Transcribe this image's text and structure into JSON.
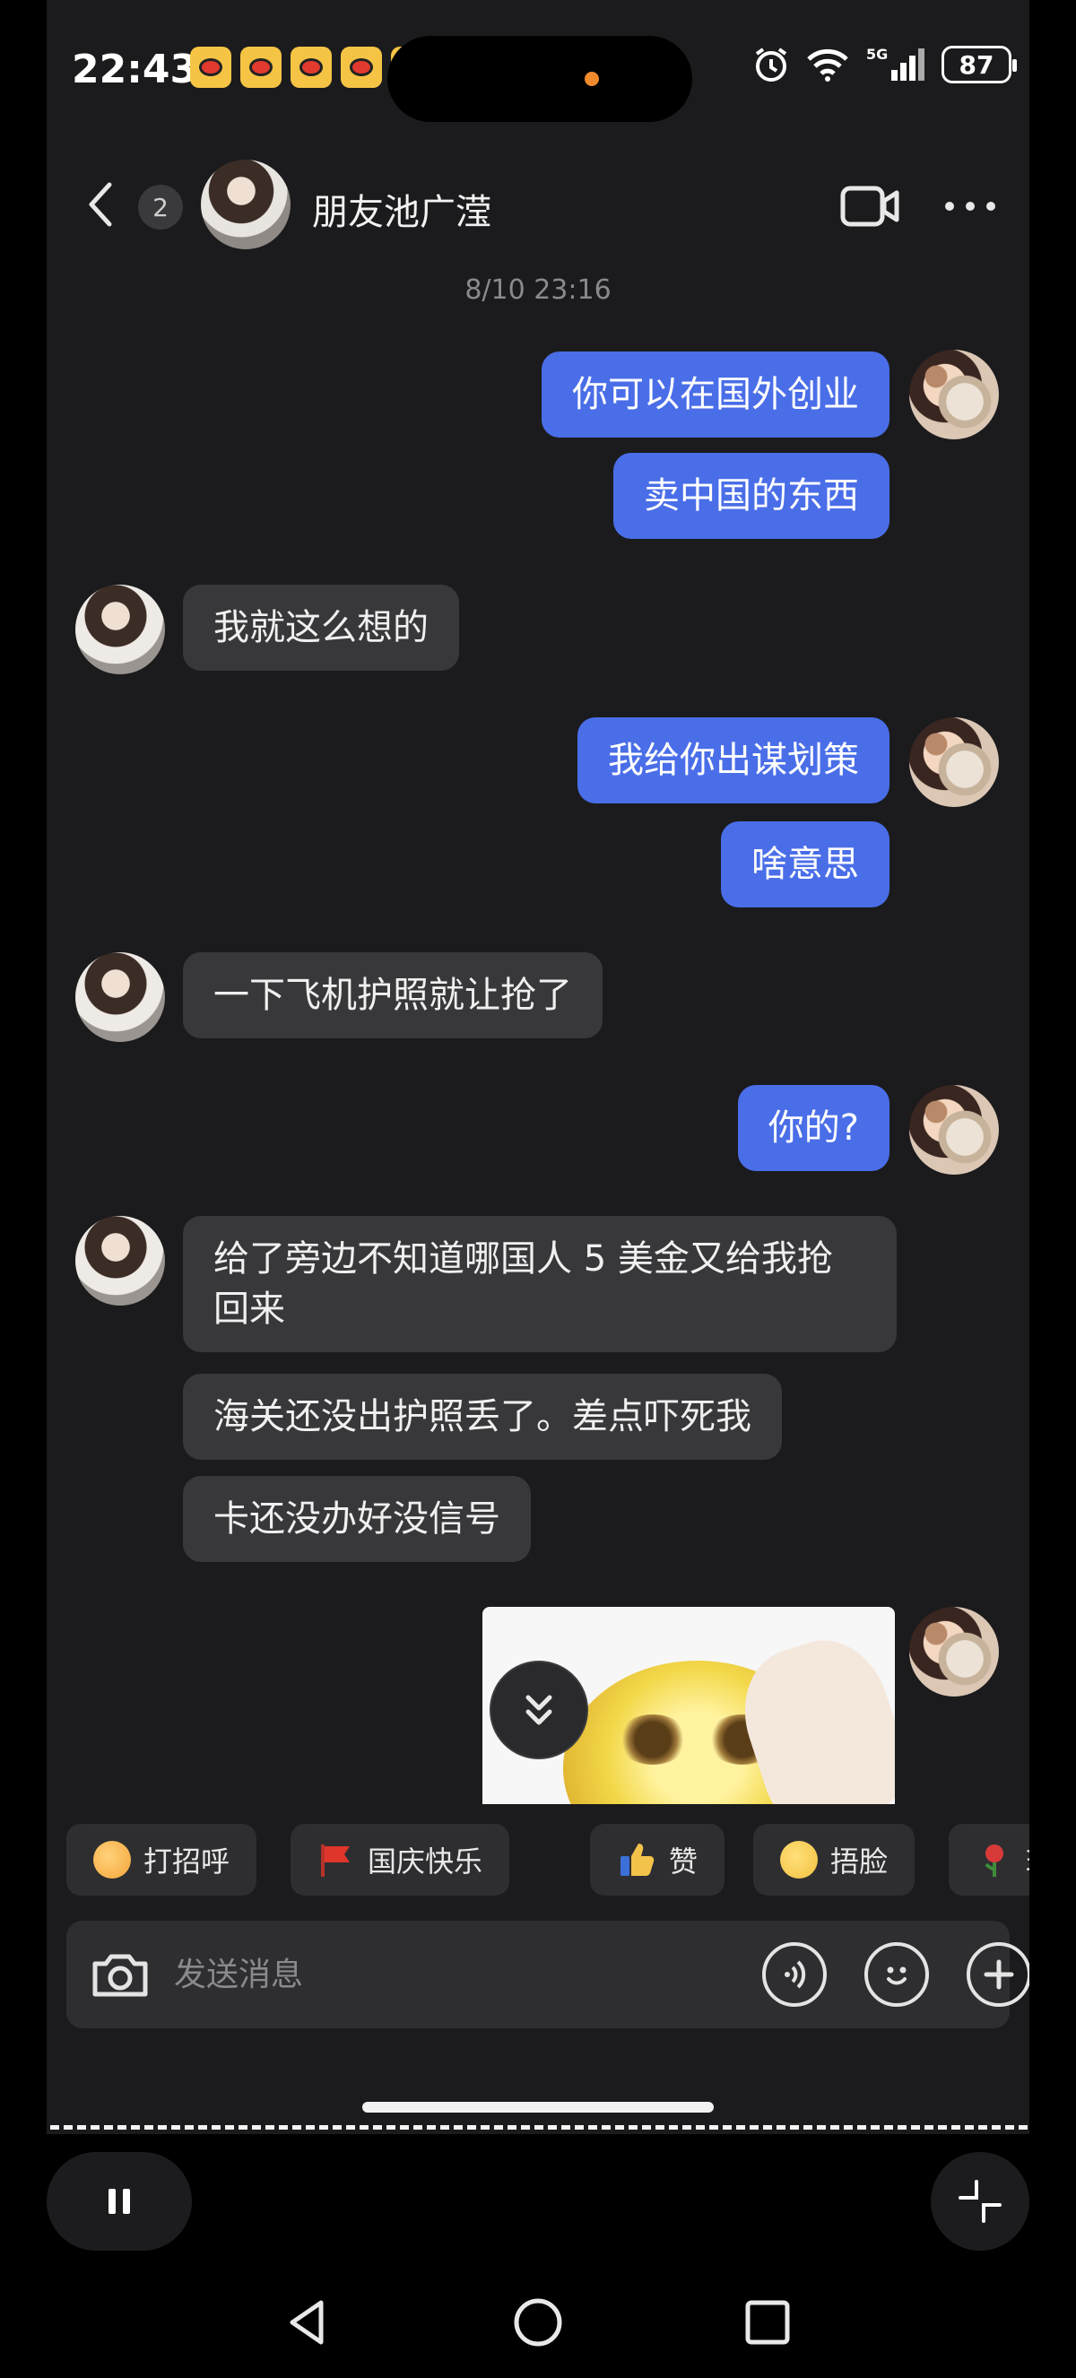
{
  "status_bar": {
    "time": "22:43",
    "dots": "···",
    "battery": "87",
    "network": "5G"
  },
  "header": {
    "unread_count": "2",
    "contact_name": "朋友池广滢"
  },
  "timestamp": "8/10 23:16",
  "messages": [
    {
      "side": "out",
      "text": "你可以在国外创业"
    },
    {
      "side": "out",
      "text": "卖中国的东西"
    },
    {
      "side": "in",
      "text": "我就这么想的"
    },
    {
      "side": "out",
      "text": "我给你出谋划策"
    },
    {
      "side": "out",
      "text": "啥意思"
    },
    {
      "side": "in",
      "text": "一下飞机护照就让抢了"
    },
    {
      "side": "out",
      "text": "你的?"
    },
    {
      "side": "in",
      "text": "给了旁边不知道哪国人 5 美金又给我抢回来"
    },
    {
      "side": "in",
      "text": "海关还没出护照丢了。差点吓死我"
    },
    {
      "side": "in",
      "text": "卡还没办好没信号"
    }
  ],
  "quick_replies": [
    {
      "label": "打招呼",
      "icon": "smile-emoji-icon",
      "color": "#f4b24a"
    },
    {
      "label": "国庆快乐",
      "icon": "red-flag-icon",
      "color": "#e0352b"
    },
    {
      "label": "赞",
      "icon": "thumbs-up-icon",
      "color": "#f3c24a"
    },
    {
      "label": "捂脸",
      "icon": "facepalm-emoji-icon",
      "color": "#f2c040"
    },
    {
      "label": "玫瑰",
      "icon": "rose-icon",
      "color": "#d83a3a"
    }
  ],
  "input": {
    "placeholder": "发送消息"
  },
  "colors": {
    "outgoing_bubble": "#4a6ee8",
    "incoming_bubble": "#38383b",
    "background": "#1b1b1d"
  }
}
